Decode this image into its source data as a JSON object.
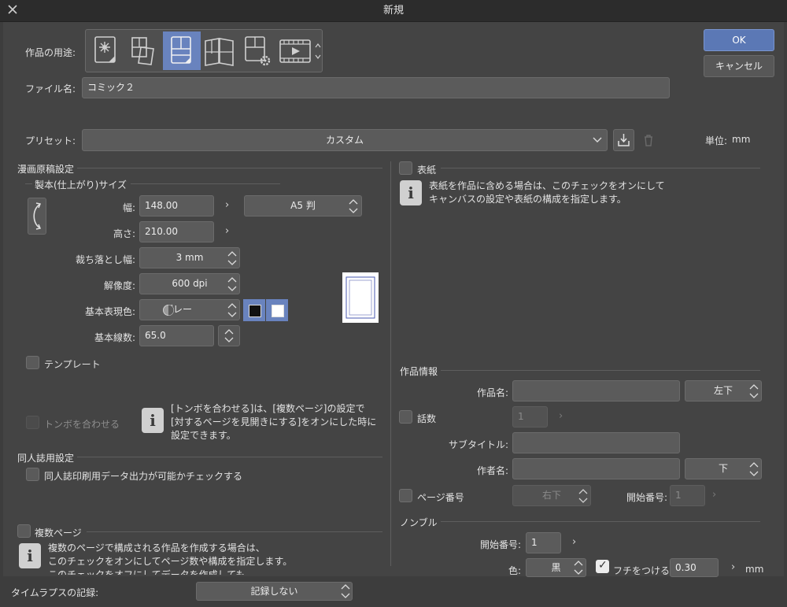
{
  "window": {
    "title": "新規"
  },
  "usage": {
    "label": "作品の用途:",
    "items": [
      "illustration-icon",
      "webtoon-icon",
      "comic-icon",
      "print-spread-icon",
      "custom-settings-icon",
      "animation-icon"
    ],
    "selected": 2
  },
  "buttons": {
    "ok": "OK",
    "cancel": "キャンセル"
  },
  "filename": {
    "label": "ファイル名:",
    "value": "コミック２"
  },
  "preset": {
    "label": "プリセット:",
    "value": "カスタム",
    "unit_label": "単位:",
    "unit_value": "mm"
  },
  "manga": {
    "section": "漫画原稿設定",
    "binding_section": "製本(仕上がり)サイズ",
    "width_label": "幅:",
    "width_value": "148.00",
    "size_preset": "A5 判",
    "height_label": "高さ:",
    "height_value": "210.00",
    "bleed_label": "裁ち落とし幅:",
    "bleed_value": "3 mm",
    "resolution_label": "解像度:",
    "resolution_value": "600 dpi",
    "color_label": "基本表現色:",
    "color_value": "グレー",
    "lines_label": "基本線数:",
    "lines_value": "65.0",
    "template_label": "テンプレート",
    "tombo_label": "トンボを合わせる",
    "tombo_info": [
      "[トンボを合わせる]は、[複数ページ]の設定で",
      "[対するページを見開きにする]をオンにした時に",
      "設定できます。"
    ]
  },
  "doujin": {
    "section": "同人誌用設定",
    "check_label": "同人誌印刷用データ出力が可能かチェックする"
  },
  "multi": {
    "label": "複数ページ",
    "info": [
      "複数のページで構成される作品を作成する場合は、",
      "このチェックをオンにしてページ数や構成を指定します。",
      "このチェックをオフにしてデータを作成しても"
    ]
  },
  "cover": {
    "label": "表紙",
    "info": [
      "表紙を作品に含める場合は、このチェックをオンにして",
      "キャンバスの設定や表紙の構成を指定します。"
    ]
  },
  "work": {
    "section": "作品情報",
    "title_label": "作品名:",
    "title_pos": "左下",
    "episode_label": "話数",
    "episode_value": "1",
    "subtitle_label": "サブタイトル:",
    "author_label": "作者名:",
    "author_pos": "下",
    "page_label": "ページ番号",
    "page_pos": "右下",
    "start_label": "開始番号:",
    "start_value": "1"
  },
  "nombre": {
    "section": "ノンブル",
    "start_label": "開始番号:",
    "start_value": "1",
    "color_label": "色:",
    "color_value": "黒",
    "edge_label": "フチをつける",
    "edge_value": "0.30",
    "edge_unit": "mm"
  },
  "timelapse": {
    "label": "タイムラプスの記録:",
    "value": "記録しない"
  }
}
